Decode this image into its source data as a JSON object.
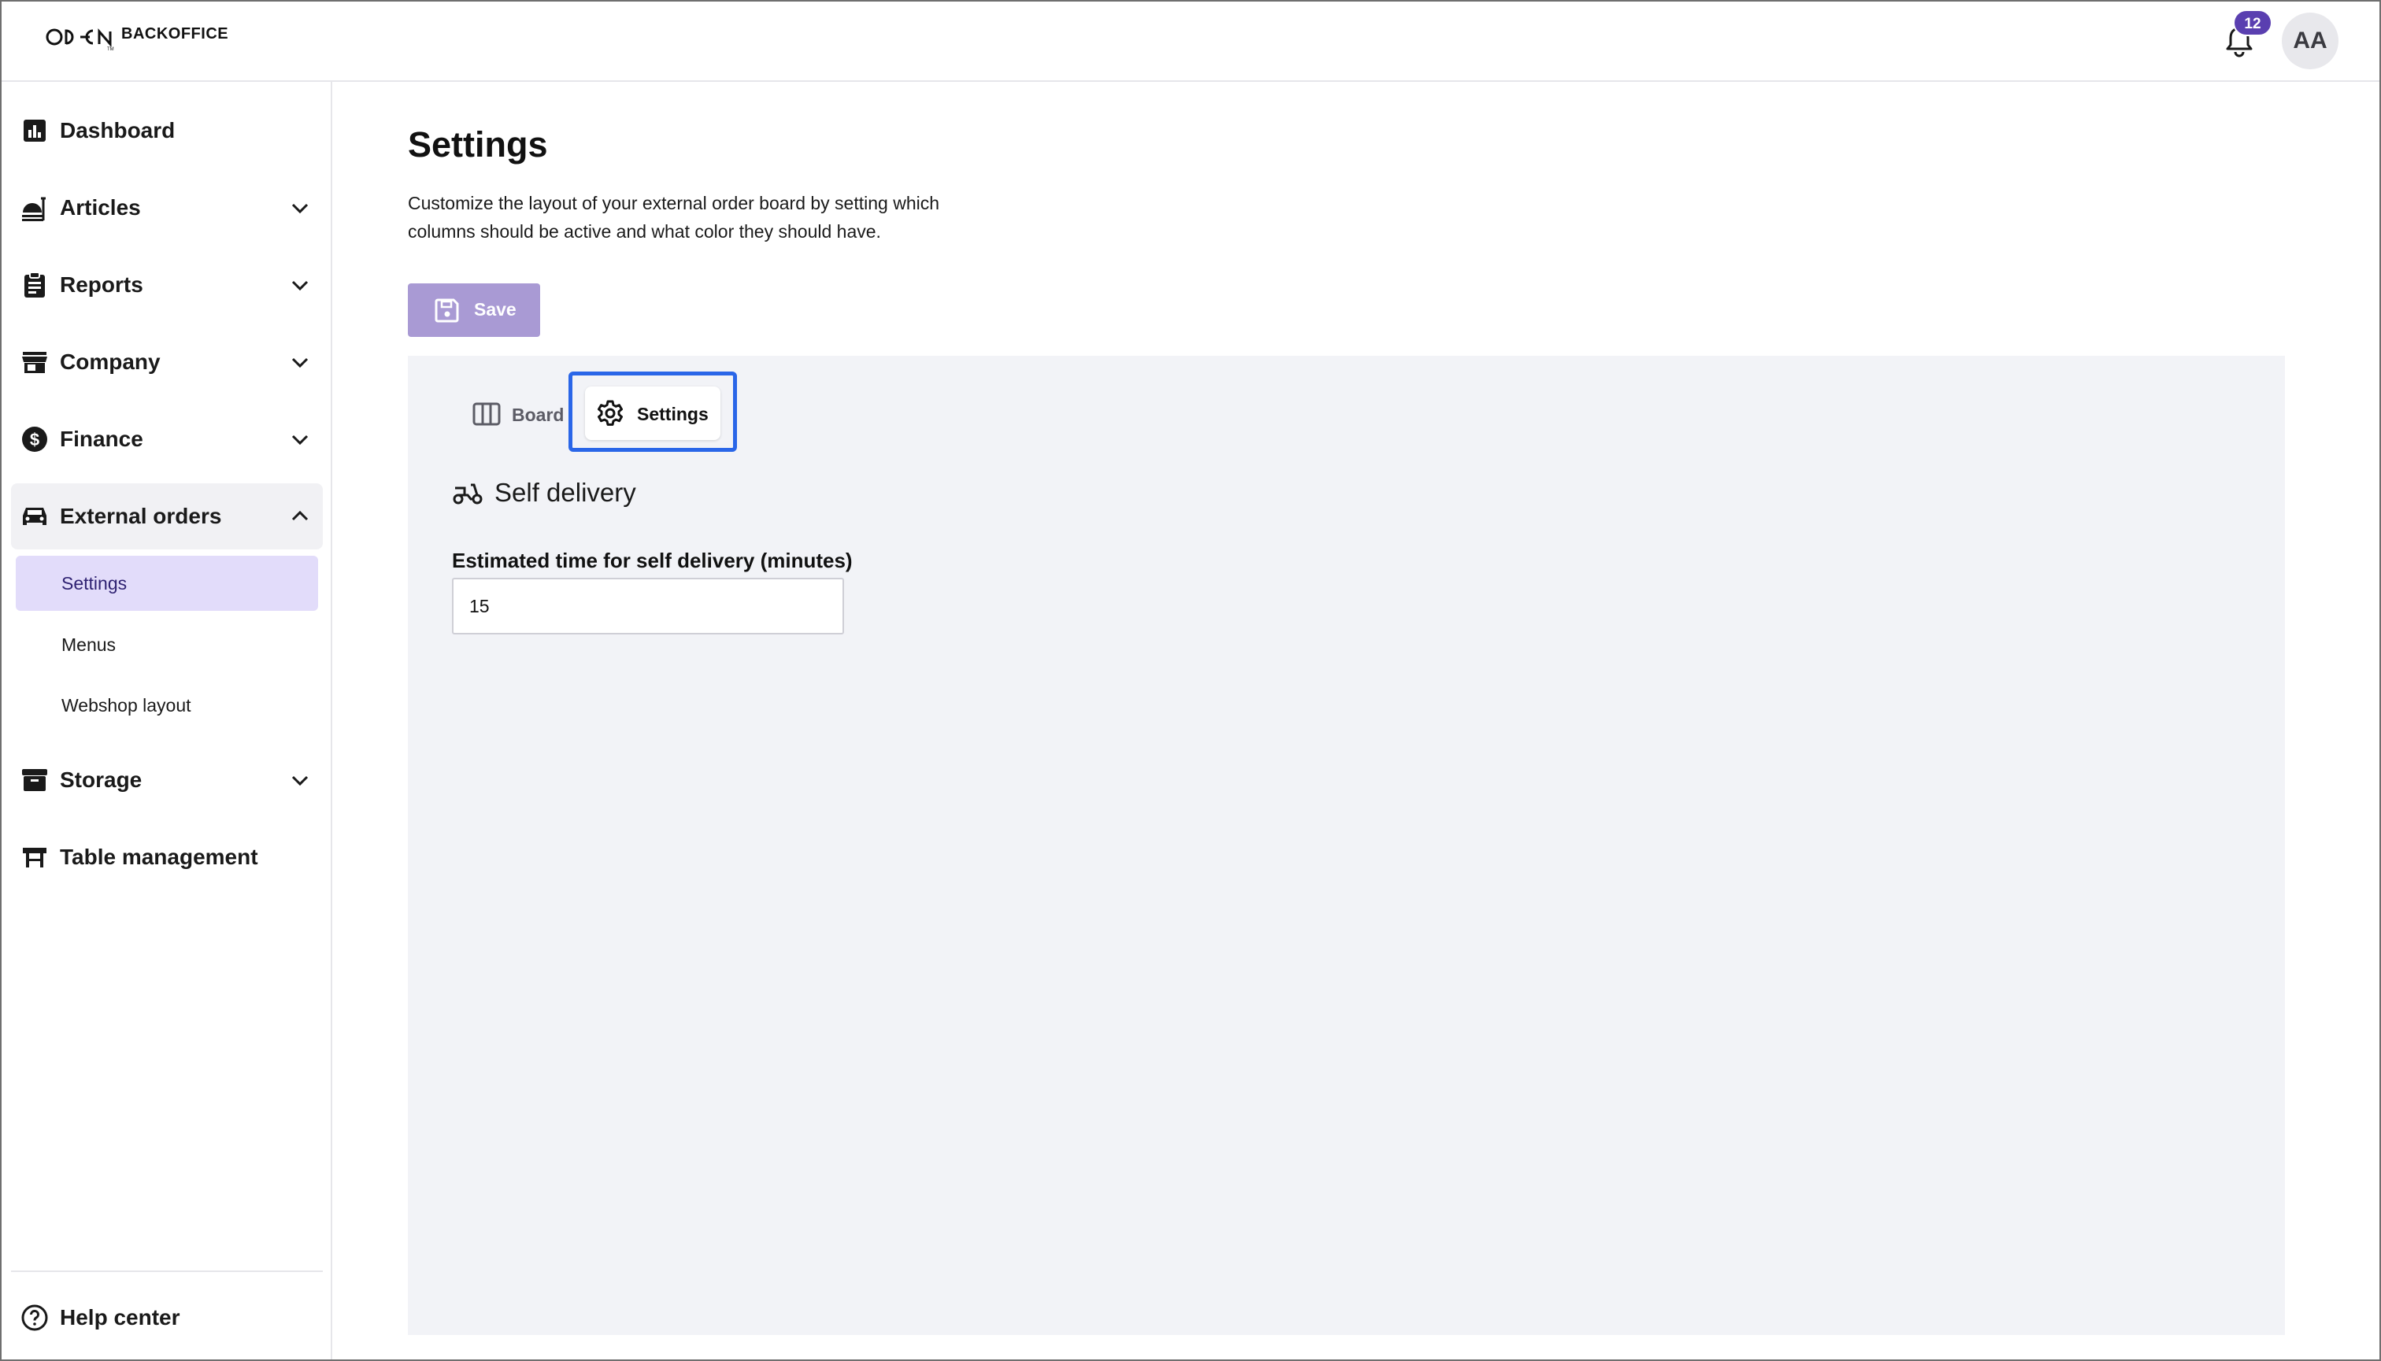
{
  "brand": {
    "logo_text": "BACKOFFICE"
  },
  "header": {
    "notification_count": "12",
    "avatar_initials": "AA"
  },
  "sidebar": {
    "items": [
      {
        "label": "Dashboard",
        "icon": "bar-chart-icon"
      },
      {
        "label": "Articles",
        "icon": "food-icon"
      },
      {
        "label": "Reports",
        "icon": "clipboard-icon"
      },
      {
        "label": "Company",
        "icon": "store-icon"
      },
      {
        "label": "Finance",
        "icon": "dollar-icon"
      },
      {
        "label": "External orders",
        "icon": "car-icon"
      },
      {
        "label": "Storage",
        "icon": "archive-icon"
      },
      {
        "label": "Table management",
        "icon": "table-icon"
      }
    ],
    "external_orders_subitems": [
      {
        "label": "Settings",
        "active": true
      },
      {
        "label": "Menus",
        "active": false
      },
      {
        "label": "Webshop layout",
        "active": false
      }
    ],
    "help_center": "Help center"
  },
  "main": {
    "title": "Settings",
    "description": "Customize the layout of your external order board by setting which columns should be active and what color they should have.",
    "save_label": "Save",
    "tabs": [
      {
        "label": "Board",
        "active": false
      },
      {
        "label": "Settings",
        "active": true
      }
    ],
    "section": {
      "title": "Self delivery",
      "field_label": "Estimated time for self delivery (minutes)",
      "field_value": "15"
    }
  },
  "colors": {
    "accent": "#5a3fb0",
    "active_subitem_bg": "#e2dcfa",
    "save_button": "#a99ad4",
    "focus_outline": "#2a66e8",
    "panel_bg": "#f2f3f7"
  }
}
